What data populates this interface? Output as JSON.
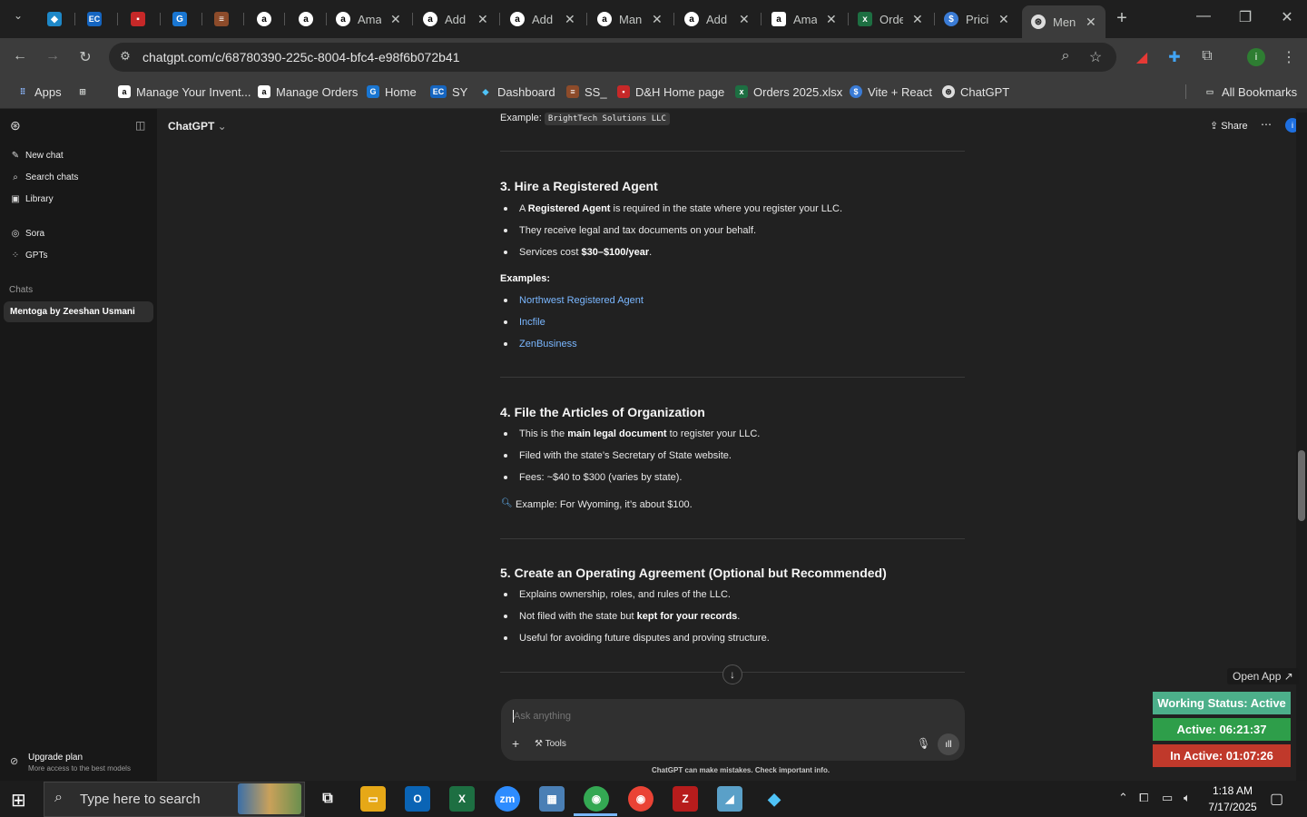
{
  "browser": {
    "tabs": [
      {
        "title": "",
        "icon": "blue-diamond-icon"
      },
      {
        "title": "",
        "icon": "ec-icon"
      },
      {
        "title": "",
        "icon": "red-pdf-icon"
      },
      {
        "title": "",
        "icon": "blue-g-icon"
      },
      {
        "title": "",
        "icon": "stack-icon"
      },
      {
        "title": "",
        "icon": "amazon-icon"
      },
      {
        "title": "",
        "icon": "amazon-icon"
      },
      {
        "title": "Ama",
        "icon": "amazon-icon"
      },
      {
        "title": "Add",
        "icon": "amazon-icon"
      },
      {
        "title": "Add",
        "icon": "amazon-icon"
      },
      {
        "title": "Man",
        "icon": "amazon-icon"
      },
      {
        "title": "Add",
        "icon": "amazon-icon"
      },
      {
        "title": "Ama",
        "icon": "amazon-icon"
      },
      {
        "title": "Orde",
        "icon": "excel-icon"
      },
      {
        "title": "Prici",
        "icon": "dollar-icon"
      },
      {
        "title": "Men",
        "icon": "openai-icon",
        "active": true
      }
    ],
    "url": "chatgpt.com/c/68780390-225c-8004-bfc4-e98f6b072b41",
    "bookmarks": [
      {
        "label": "Apps",
        "icon": "apps-grid-icon"
      },
      {
        "label": "",
        "icon": "tab-groups-icon"
      },
      {
        "label": "Manage Your Invent...",
        "icon": "amazon-icon"
      },
      {
        "label": "Manage Orders",
        "icon": "amazon-icon"
      },
      {
        "label": "Home",
        "icon": "blue-g-icon"
      },
      {
        "label": "SY",
        "icon": "ec-icon"
      },
      {
        "label": "Dashboard",
        "icon": "diamond-icon"
      },
      {
        "label": "SS_",
        "icon": "stack-icon"
      },
      {
        "label": "D&H Home page",
        "icon": "dh-icon"
      },
      {
        "label": "Orders 2025.xlsx",
        "icon": "excel-icon"
      },
      {
        "label": "Vite + React",
        "icon": "dollar-icon"
      },
      {
        "label": "ChatGPT",
        "icon": "openai-icon"
      }
    ],
    "all_bookmarks": "All Bookmarks"
  },
  "sidebar": {
    "items": [
      {
        "label": "New chat",
        "icon": "edit-icon"
      },
      {
        "label": "Search chats",
        "icon": "search-icon"
      },
      {
        "label": "Library",
        "icon": "library-icon"
      },
      {
        "label": "Sora",
        "icon": "sora-icon"
      },
      {
        "label": "GPTs",
        "icon": "gpts-icon"
      }
    ],
    "chats_heading": "Chats",
    "chat_title": "Mentoga by Zeeshan Usmani",
    "upgrade_title": "Upgrade plan",
    "upgrade_sub": "More access to the best models"
  },
  "header": {
    "model": "ChatGPT",
    "share": "Share"
  },
  "content": {
    "example_prefix": "Example:",
    "example_code": "BrightTech Solutions LLC",
    "s3_title": "3. Hire a Registered Agent",
    "s3_b1_pre": "A ",
    "s3_b1_bold": "Registered Agent",
    "s3_b1_post": " is required in the state where you register your LLC.",
    "s3_b2": "They receive legal and tax documents on your behalf.",
    "s3_b3_pre": "Services cost ",
    "s3_b3_bold": "$30–$100/year",
    "s3_b3_post": ".",
    "examples_label": "Examples:",
    "links": [
      "Northwest Registered Agent",
      "Incfile",
      "ZenBusiness"
    ],
    "s4_title": "4. File the Articles of Organization",
    "s4_b1_pre": "This is the ",
    "s4_b1_bold": "main legal document",
    "s4_b1_post": " to register your LLC.",
    "s4_b2": "Filed with the state’s Secretary of State website.",
    "s4_b3": "Fees: ~$40 to $300 (varies by state).",
    "s4_note": "Example: For Wyoming, it’s about $100.",
    "s5_title": "5. Create an Operating Agreement (Optional but Recommended)",
    "s5_b1": "Explains ownership, roles, and rules of the LLC.",
    "s5_b2_pre": "Not filed with the state but ",
    "s5_b2_bold": "kept for your records",
    "s5_b2_post": ".",
    "s5_b3": "Useful for avoiding future disputes and proving structure."
  },
  "composer": {
    "placeholder": "Ask anything",
    "tools": "Tools",
    "disclaimer": "ChatGPT can make mistakes. Check important info."
  },
  "widgets": {
    "open_app": "Open App ↗",
    "working_status": "Working Status: Active",
    "active": "Active: 06:21:37",
    "inactive": "In Active: 01:07:26",
    "colors": {
      "working": "#4caf8a",
      "active": "#2e9e4a",
      "inactive": "#c0392b"
    }
  },
  "taskbar": {
    "search_placeholder": "Type here to search",
    "time": "1:18 AM",
    "date": "7/17/2025"
  }
}
